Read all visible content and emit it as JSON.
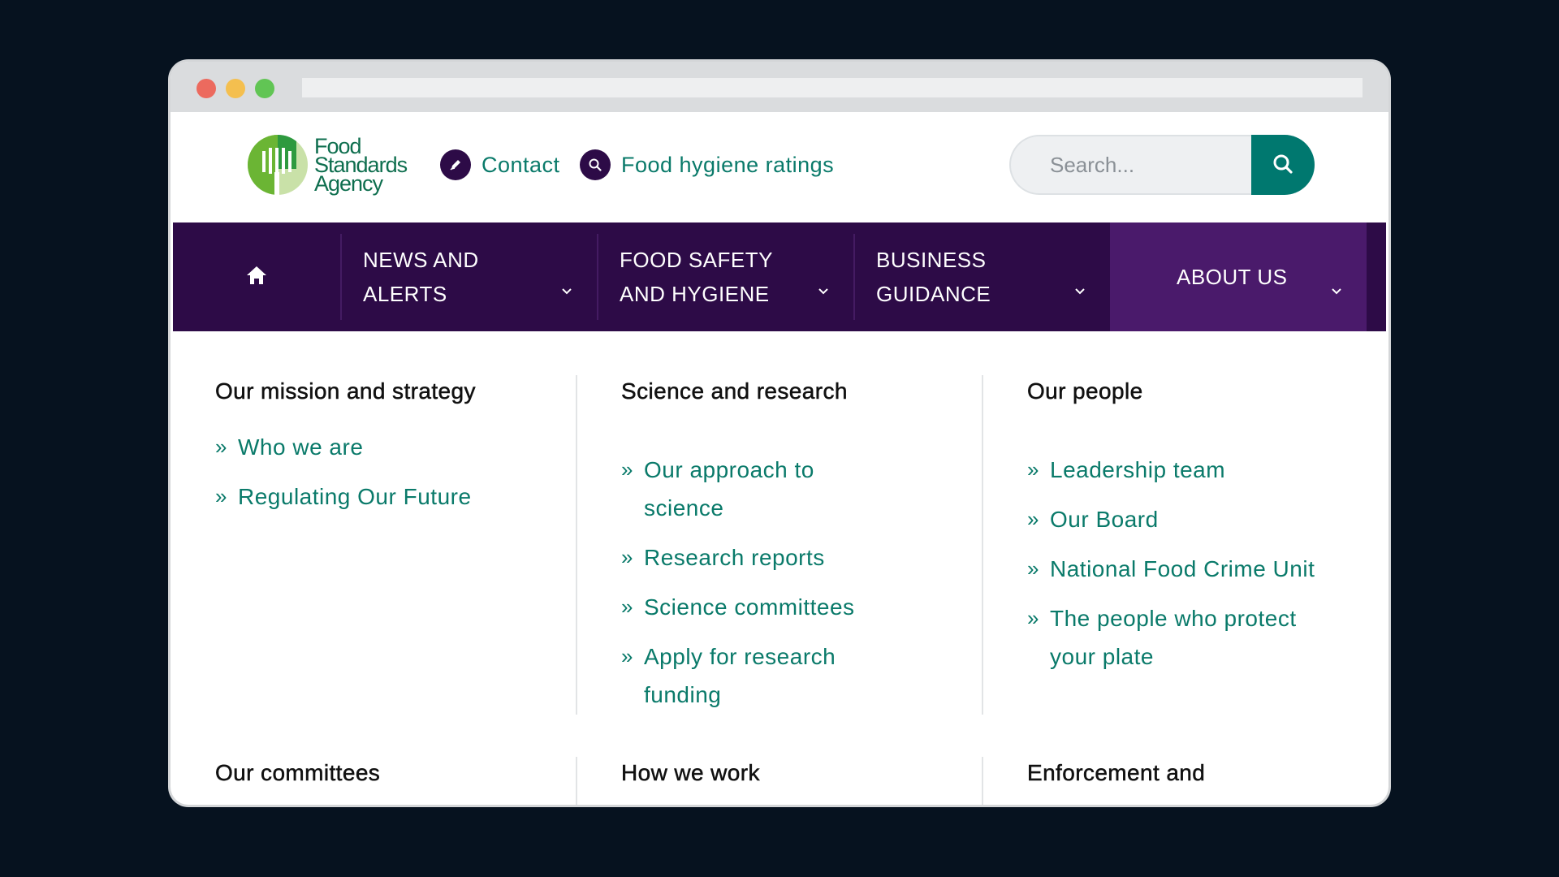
{
  "browser": {
    "window_controls": [
      "close",
      "minimize",
      "maximize"
    ]
  },
  "header": {
    "logo": {
      "line1": "Food",
      "line2": "Standards",
      "line3": "Agency"
    },
    "contact_label": "Contact",
    "hygiene_label": "Food hygiene ratings",
    "search": {
      "placeholder": "Search..."
    }
  },
  "nav": {
    "items": [
      {
        "label": "NEWS AND ALERTS"
      },
      {
        "label": "FOOD SAFETY AND HYGIENE"
      },
      {
        "label": "BUSINESS GUIDANCE"
      },
      {
        "label": "ABOUT US"
      }
    ]
  },
  "mega_menu": {
    "columns": [
      {
        "heading": "Our mission and strategy",
        "links": [
          "Who we are",
          "Regulating Our Future"
        ]
      },
      {
        "heading": "Science and research",
        "links": [
          "Our approach to science",
          "Research reports",
          "Science committees",
          "Apply for research funding"
        ]
      },
      {
        "heading": "Our people",
        "links": [
          "Leadership team",
          "Our Board",
          "National Food Crime Unit",
          "The people who protect your plate"
        ]
      }
    ],
    "bottom_headings": [
      "Our committees",
      "How we work",
      "Enforcement and"
    ]
  },
  "colors": {
    "page_bg": "#06121f",
    "nav_bg": "#2d0b47",
    "nav_active_bg": "#4a1a6b",
    "link": "#0a7a6a",
    "search_button": "#00786f",
    "logo_green": "#0e6e4e"
  },
  "icons": {
    "contact": "pencil-icon",
    "hygiene": "search-icon",
    "search_button": "search-icon",
    "home": "home-icon",
    "dropdown": "chevron-down-icon"
  }
}
